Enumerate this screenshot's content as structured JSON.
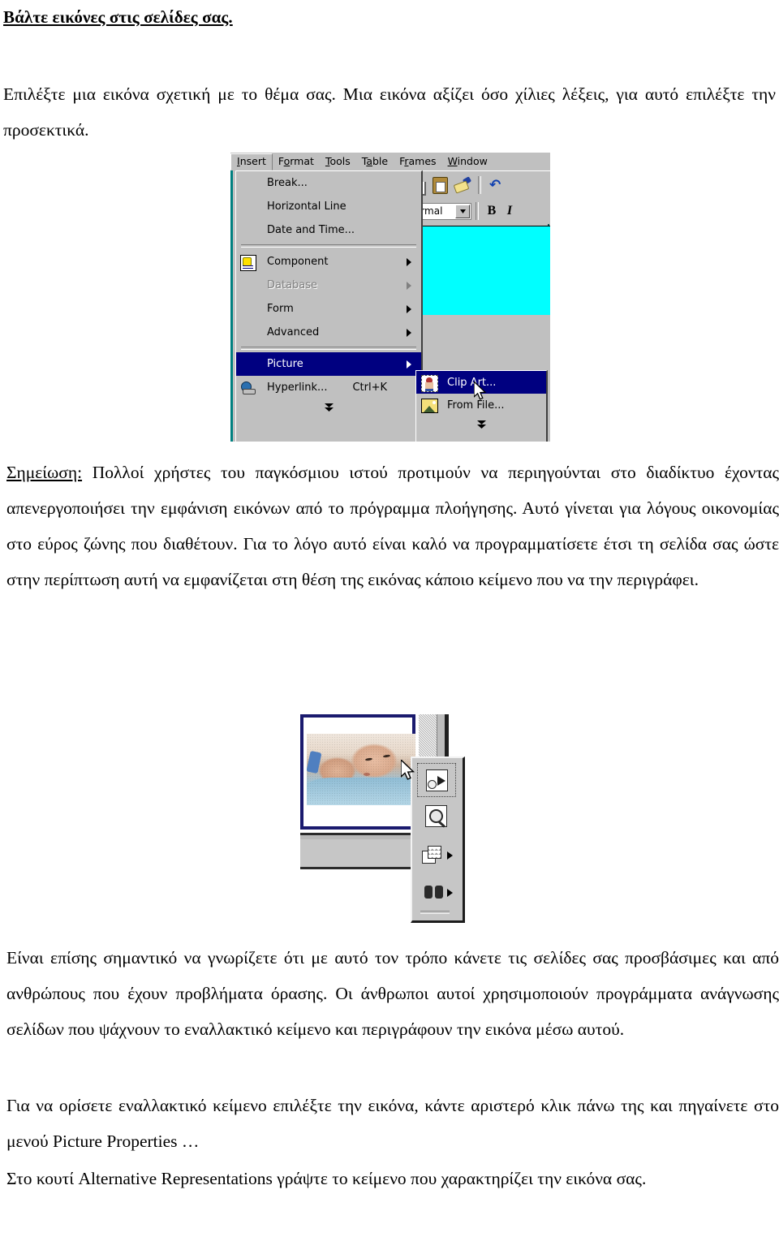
{
  "document": {
    "title": "Βάλτε εικόνες στις σελίδες σας.",
    "paragraphs": [
      "Επιλέξτε μια εικόνα σχετική με το θέμα σας. Μια εικόνα αξίζει όσο χίλιες λέξεις, για αυτό επιλέξτε την προσεκτικά.",
      "Είναι επίσης σημαντικό να γνωρίζετε ότι με αυτό τον τρόπο κάνετε τις σελίδες σας προσβάσιμες και από ανθρώπους που έχουν προβλήματα όρασης. Οι άνθρωποι αυτοί χρησιμοποιούν προγράμματα ανάγνωσης σελίδων που ψάχνουν το εναλλακτικό κείμενο και περιγράφουν την εικόνα μέσω αυτού.",
      "Για να ορίσετε εναλλακτικό κείμενο επιλέξτε την εικόνα, κάντε αριστερό κλικ πάνω της και πηγαίνετε στο μενού Picture Properties …",
      "Στο κουτί Alternative Representations γράψτε το κείμενο που χαρακτηρίζει την εικόνα σας."
    ],
    "note": {
      "label": "Σημείωση:",
      "body": " Πολλοί χρήστες του παγκόσμιου ιστού προτιμούν να περιηγούνται στο διαδίκτυο έχοντας απενεργοποιήσει την εμφάνιση εικόνων από το πρόγραμμα πλοήγησης. Αυτό γίνεται για λόγους οικονομίας στο εύρος ζώνης που διαθέτουν. Για το λόγο αυτό είναι καλό να προγραμματίσετε έτσι τη σελίδα σας ώστε στην περίπτωση αυτή να εμφανίζεται στη θέση της εικόνας κάποιο κείμενο που να την περιγράφει."
    }
  },
  "menu_screenshot": {
    "menubar": [
      {
        "label": "Insert",
        "mnemonic": "I",
        "active": true
      },
      {
        "label": "Format",
        "mnemonic": "o",
        "active": false
      },
      {
        "label": "Tools",
        "mnemonic": "T",
        "active": false
      },
      {
        "label": "Table",
        "mnemonic": "a",
        "active": false
      },
      {
        "label": "Frames",
        "mnemonic": "r",
        "active": false
      },
      {
        "label": "Window",
        "mnemonic": "W",
        "active": false
      }
    ],
    "dropdown_items": [
      {
        "label": "Break...",
        "icon": "",
        "submenu": false,
        "disabled": false,
        "selected": false,
        "accel": ""
      },
      {
        "label": "Horizontal Line",
        "icon": "",
        "submenu": false,
        "disabled": false,
        "selected": false,
        "accel": ""
      },
      {
        "label": "Date and Time...",
        "icon": "",
        "submenu": false,
        "disabled": false,
        "selected": false,
        "accel": ""
      },
      {
        "separator": true
      },
      {
        "label": "Component",
        "icon": "component-icon",
        "submenu": true,
        "disabled": false,
        "selected": false,
        "accel": ""
      },
      {
        "label": "Database",
        "icon": "",
        "submenu": true,
        "disabled": true,
        "selected": false,
        "accel": ""
      },
      {
        "label": "Form",
        "icon": "",
        "submenu": true,
        "disabled": false,
        "selected": false,
        "accel": ""
      },
      {
        "label": "Advanced",
        "icon": "",
        "submenu": true,
        "disabled": false,
        "selected": false,
        "accel": ""
      },
      {
        "separator": true
      },
      {
        "label": "Picture",
        "icon": "",
        "submenu": true,
        "disabled": false,
        "selected": true,
        "accel": ""
      },
      {
        "label": "Hyperlink...",
        "icon": "hyperlink-icon",
        "submenu": false,
        "disabled": false,
        "selected": false,
        "accel": "Ctrl+K"
      }
    ],
    "submenu_items": [
      {
        "label": "Clip Art...",
        "icon": "clipart-icon",
        "selected": true
      },
      {
        "label": "From File...",
        "icon": "fromfile-icon",
        "selected": false
      }
    ],
    "expand_chevron": "»",
    "toolbar_icons": [
      "copy-icon",
      "paste-icon",
      "format-painter-icon",
      "undo-icon"
    ],
    "style_combo_value": "Normal",
    "bold_label": "B",
    "italic_label": "I",
    "selection_color": "#00ffff",
    "highlight_color": "#000080"
  },
  "clipart_screenshot": {
    "selected_thumbnail_alt": "sleeping baby on blue blanket",
    "selection_border_color": "#1a1a6e",
    "toolbar_buttons": [
      {
        "name": "insert-clip-button",
        "icon": "insert-clip-icon",
        "has_submenu": false,
        "focused": true
      },
      {
        "name": "preview-clip-button",
        "icon": "preview-clip-icon",
        "has_submenu": false,
        "focused": false
      },
      {
        "name": "add-to-favorites-button",
        "icon": "add-to-favorites-icon",
        "has_submenu": true,
        "focused": false
      },
      {
        "name": "find-similar-clips-button",
        "icon": "find-similar-clips-icon",
        "has_submenu": true,
        "focused": false
      }
    ]
  }
}
